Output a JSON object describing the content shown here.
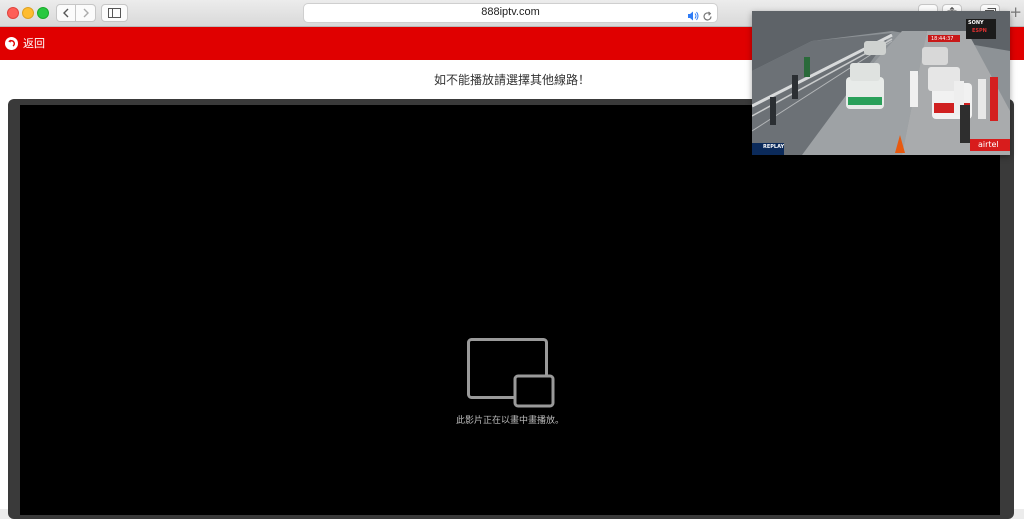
{
  "browser": {
    "url": "888iptv.com"
  },
  "header": {
    "back_label": "返回"
  },
  "page": {
    "notice": "如不能播放請選擇其他線路！"
  },
  "player": {
    "pip_message": "此影片正在以畫中畫播放。"
  },
  "pip_window": {
    "badge_replay": "REPLAY",
    "badge_sponsor": "airtel",
    "badge_network": "SONY",
    "badge_channel": "ESPN",
    "clock": "18:44:37"
  }
}
